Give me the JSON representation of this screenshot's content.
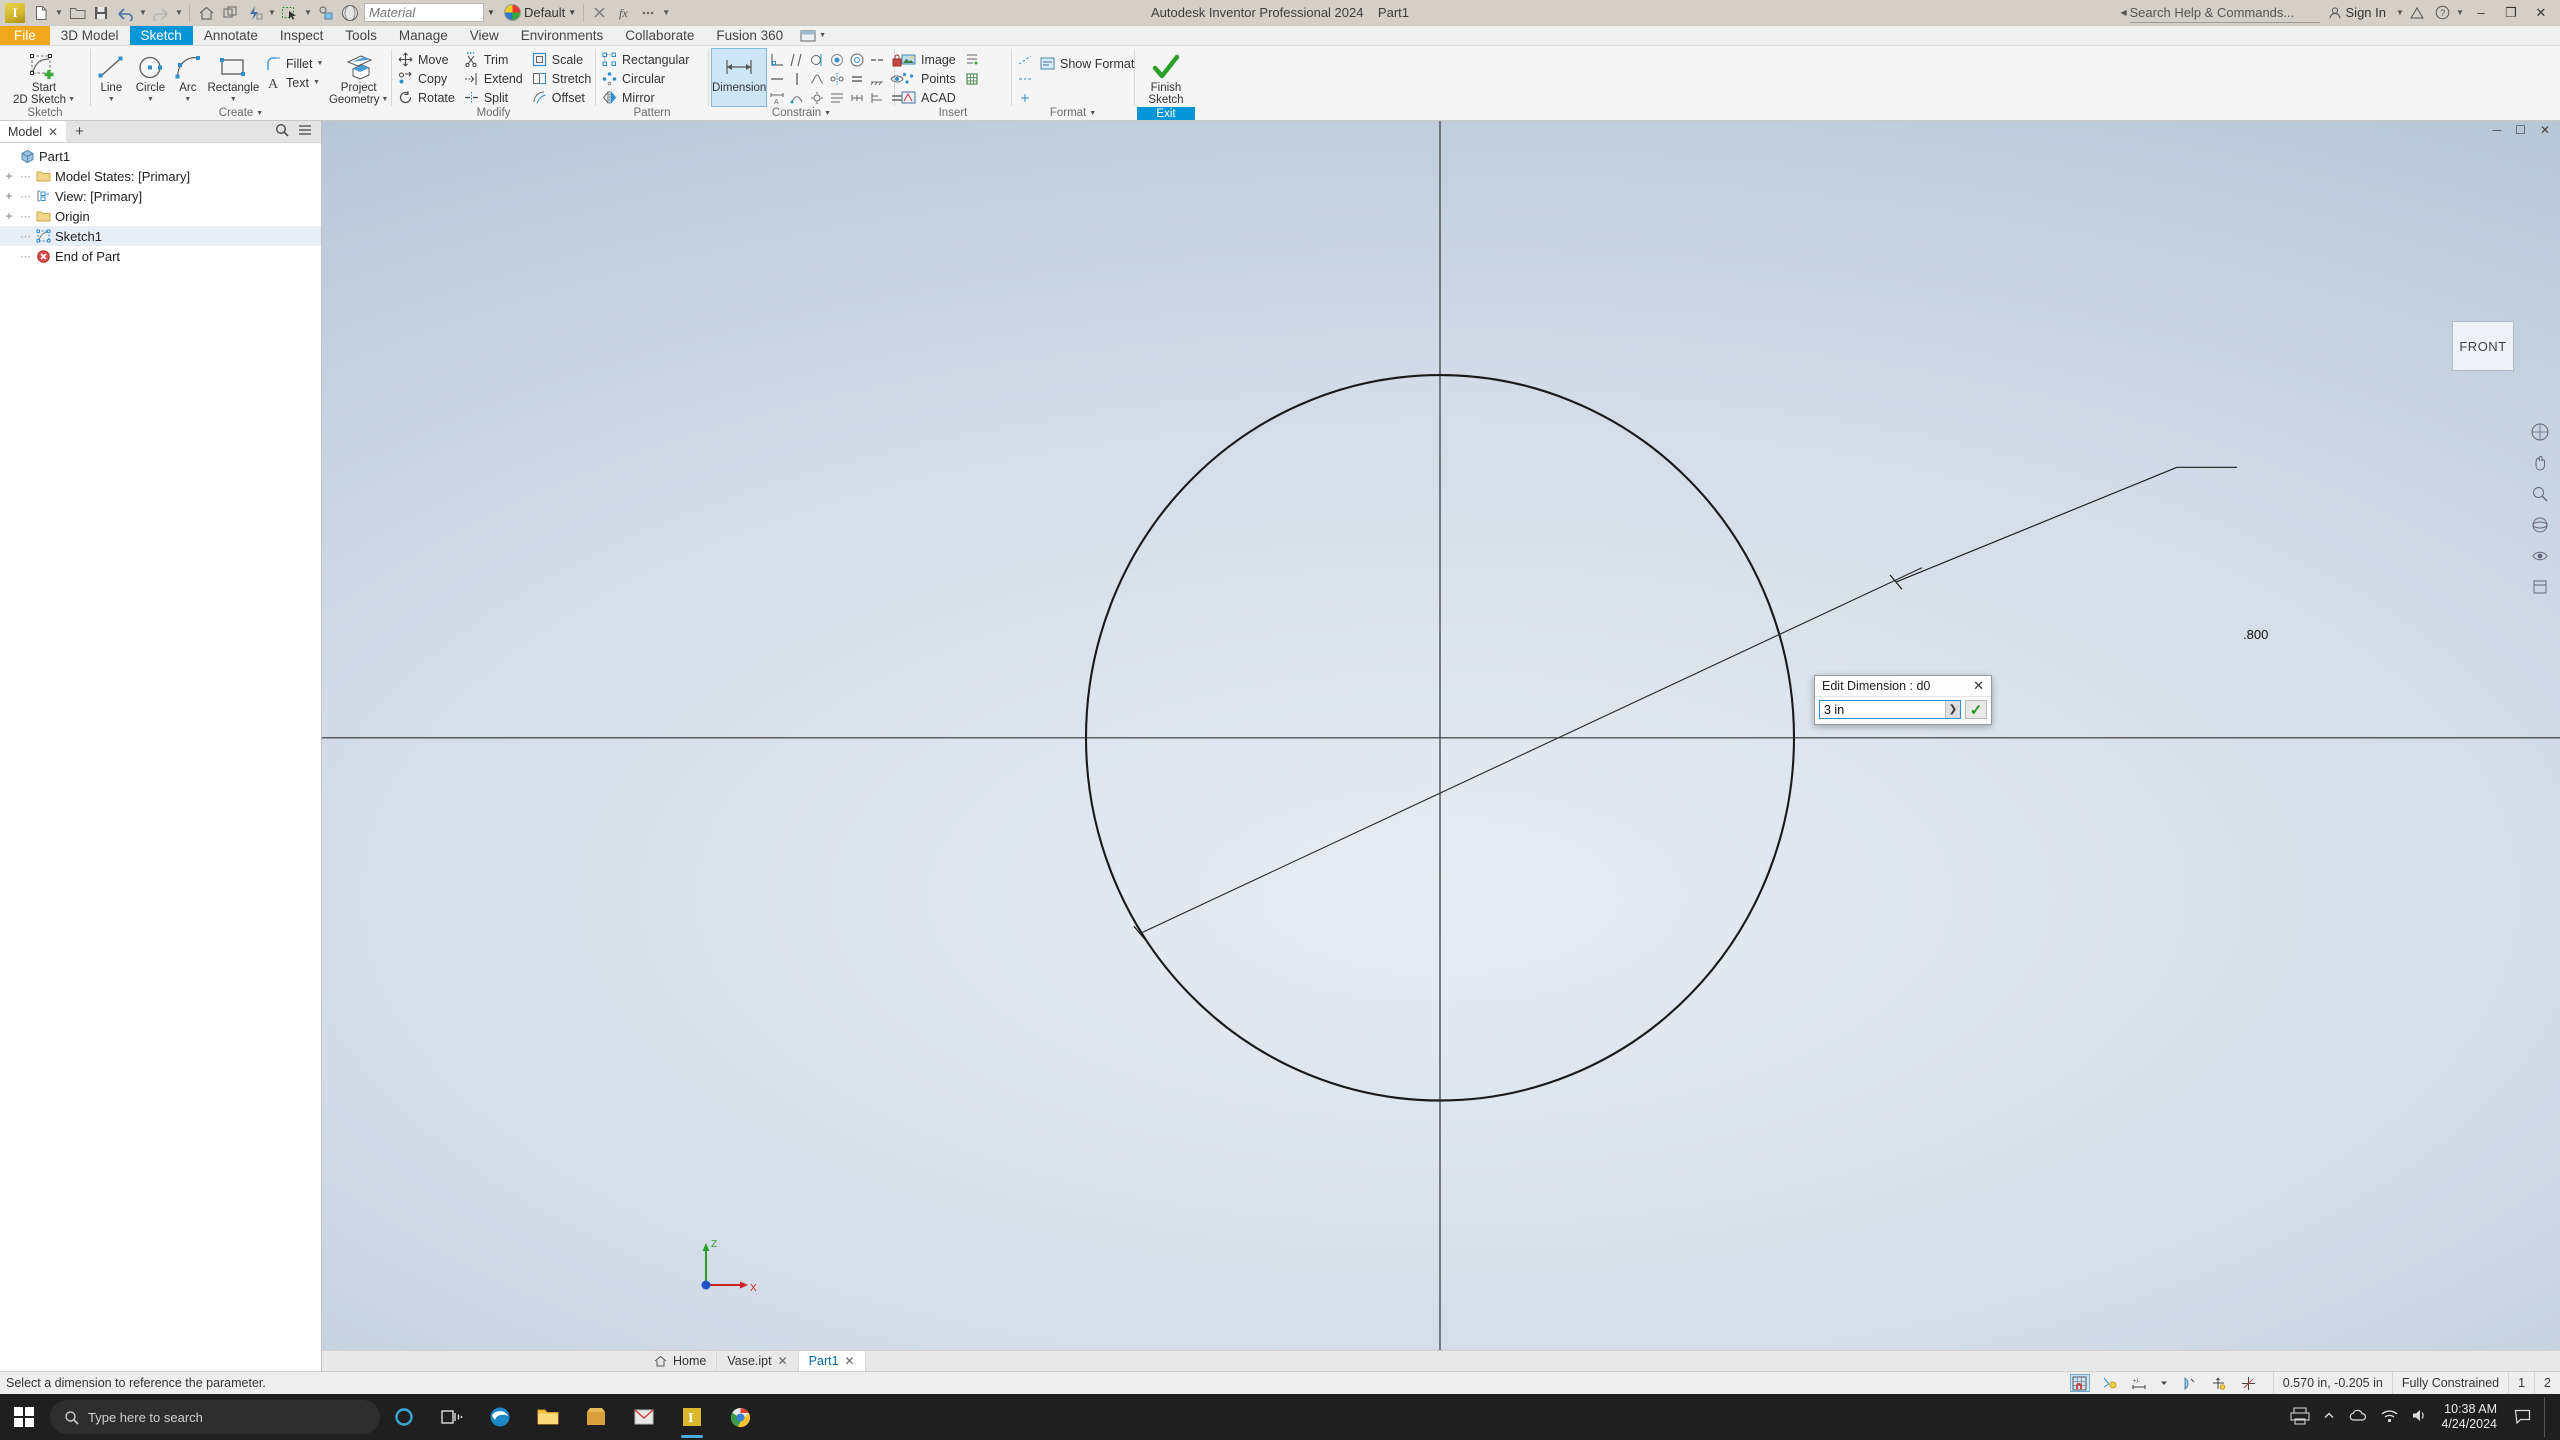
{
  "titlebar": {
    "app_title": "Autodesk Inventor Professional 2024",
    "document_name": "Part1",
    "material_placeholder": "Material",
    "appearance_value": "Default",
    "search_placeholder": "Search Help & Commands...",
    "signin_label": "Sign In",
    "minimize": "–",
    "maximize": "❐",
    "close": "✕"
  },
  "menubar": {
    "tabs": [
      {
        "label": "File",
        "style": "file"
      },
      {
        "label": "3D Model",
        "style": "normal"
      },
      {
        "label": "Sketch",
        "style": "active"
      },
      {
        "label": "Annotate",
        "style": "normal"
      },
      {
        "label": "Inspect",
        "style": "normal"
      },
      {
        "label": "Tools",
        "style": "normal"
      },
      {
        "label": "Manage",
        "style": "normal"
      },
      {
        "label": "View",
        "style": "normal"
      },
      {
        "label": "Environments",
        "style": "normal"
      },
      {
        "label": "Collaborate",
        "style": "normal"
      },
      {
        "label": "Fusion 360",
        "style": "normal"
      }
    ]
  },
  "ribbon": {
    "panels": [
      {
        "label": "Sketch",
        "big": [
          {
            "label_line1": "Start",
            "label_line2": "2D Sketch",
            "icon": "start-2d-sketch-icon",
            "caret": true
          }
        ]
      },
      {
        "label": "Create",
        "label_caret": true,
        "big": [
          {
            "label_line1": "Line",
            "icon": "line-icon",
            "caret": true
          },
          {
            "label_line1": "Circle",
            "icon": "circle-icon",
            "caret": true
          },
          {
            "label_line1": "Arc",
            "icon": "arc-icon",
            "caret": true
          },
          {
            "label_line1": "Rectangle",
            "icon": "rectangle-icon",
            "caret": true
          }
        ],
        "small": [
          {
            "label": "Fillet",
            "icon": "fillet-icon",
            "caret": true
          },
          {
            "label": "Text",
            "icon": "text-icon",
            "caret": true
          }
        ],
        "big2": [
          {
            "label_line1": "Project",
            "label_line2": "Geometry",
            "icon": "project-geometry-icon",
            "caret": true
          }
        ]
      },
      {
        "label": "Modify",
        "label_caret": false,
        "cols": [
          [
            {
              "label": "Move",
              "icon": "move-icon"
            },
            {
              "label": "Copy",
              "icon": "copy-icon"
            },
            {
              "label": "Rotate",
              "icon": "rotate-icon"
            }
          ],
          [
            {
              "label": "Trim",
              "icon": "trim-icon"
            },
            {
              "label": "Extend",
              "icon": "extend-icon"
            },
            {
              "label": "Split",
              "icon": "split-icon"
            }
          ],
          [
            {
              "label": "Scale",
              "icon": "scale-icon"
            },
            {
              "label": "Stretch",
              "icon": "stretch-icon"
            },
            {
              "label": "Offset",
              "icon": "offset-icon"
            }
          ]
        ]
      },
      {
        "label": "Pattern",
        "cols": [
          [
            {
              "label": "Rectangular",
              "icon": "rectangular-pattern-icon"
            },
            {
              "label": "Circular",
              "icon": "circular-pattern-icon"
            },
            {
              "label": "Mirror",
              "icon": "mirror-icon"
            }
          ]
        ]
      },
      {
        "label": "Constrain",
        "label_caret": true,
        "big": [
          {
            "label_line1": "Dimension",
            "icon": "dimension-icon",
            "selected": true
          }
        ],
        "icon_grid": [
          "perpendicular-constraint-icon",
          "parallel-constraint-icon",
          "tangent-constraint-icon",
          "coincident-constraint-icon",
          "concentric-constraint-icon",
          "collinear-constraint-icon",
          "lock-constraint-icon",
          "horizontal-constraint-icon",
          "vertical-constraint-icon",
          "smooth-constraint-icon",
          "symmetric-constraint-icon",
          "equal-constraint-icon",
          "fix-constraint-icon",
          "show-constraints-icon",
          "auto-dimension-icon",
          "relax-mode-icon",
          "constraint-settings-icon",
          "offset-dim-icon",
          "chain-dim-icon",
          "baseline-dim-icon",
          "equal-icon"
        ]
      },
      {
        "label": "Insert",
        "small": [
          {
            "label": "Image",
            "icon": "image-icon"
          },
          {
            "label": "Points",
            "icon": "points-icon"
          },
          {
            "label": "ACAD",
            "icon": "acad-icon"
          }
        ],
        "icon_grid": [
          "import-points-icon",
          "import-excel-icon"
        ]
      },
      {
        "label": "Format",
        "label_caret": true,
        "small": [
          {
            "label": "Show Format",
            "icon": "show-format-icon"
          }
        ],
        "icon_grid": [
          "construction-line-icon",
          "centerline-icon",
          "center-point-icon",
          "driven-dim-icon"
        ]
      },
      {
        "label": "Exit",
        "big": [
          {
            "label_line1": "Finish",
            "label_line2": "Sketch",
            "icon": "finish-sketch-icon"
          }
        ]
      }
    ]
  },
  "browser": {
    "tab_label": "Model",
    "tab_close": "✕",
    "add_tab": "+",
    "search_icon": "search-icon",
    "menu_icon": "hamburger-menu-icon",
    "tree": [
      {
        "label": "Part1",
        "icon": "part-icon",
        "indent": 0,
        "expander": "",
        "selected": false
      },
      {
        "label": "Model States: [Primary]",
        "icon": "folder-icon",
        "indent": 1,
        "expander": "+",
        "selected": false
      },
      {
        "label": "View: [Primary]",
        "icon": "view-icon",
        "indent": 1,
        "expander": "+",
        "selected": false
      },
      {
        "label": "Origin",
        "icon": "folder-icon",
        "indent": 1,
        "expander": "+",
        "selected": false
      },
      {
        "label": "Sketch1",
        "icon": "sketch-icon",
        "indent": 1,
        "expander": "",
        "selected": true
      },
      {
        "label": "End of Part",
        "icon": "end-of-part-icon",
        "indent": 1,
        "expander": "",
        "selected": false
      }
    ]
  },
  "canvas": {
    "viewcube_label": "FRONT",
    "dimension_label": ".800"
  },
  "edit_dimension": {
    "title": "Edit Dimension : d0",
    "close": "✕",
    "value": "3 in",
    "expand_arrow": "❯",
    "accept": "✓"
  },
  "doctabs": {
    "home_label": "Home",
    "tabs": [
      {
        "label": "Vase.ipt",
        "active": false,
        "close": "✕"
      },
      {
        "label": "Part1",
        "active": true,
        "close": "✕"
      }
    ]
  },
  "statusbar": {
    "message": "Select a dimension to reference the parameter.",
    "coordinates": "0.570 in, -0.205 in",
    "constraint_state": "Fully Constrained",
    "count_1": "1",
    "count_2": "2",
    "icons": [
      "grid-snap-icon",
      "constraint-visibility-icon",
      "dimension-visibility-icon",
      "slice-graphics-icon",
      "dof-icon",
      "analyze-icon"
    ]
  },
  "taskbar": {
    "search_placeholder": "Type here to search",
    "clock_time": "10:38 AM",
    "clock_date": "4/24/2024",
    "apps": [
      "task-view-icon",
      "edge-icon",
      "file-explorer-icon",
      "store-icon",
      "mail-icon",
      "inventor-icon",
      "chrome-icon"
    ]
  },
  "colors": {
    "accent_blue": "#0696d7",
    "file_orange": "#f0a71b",
    "selection": "#e8eef6",
    "canvas_light": "#e6ecf3",
    "canvas_dark": "#aab8ca"
  }
}
